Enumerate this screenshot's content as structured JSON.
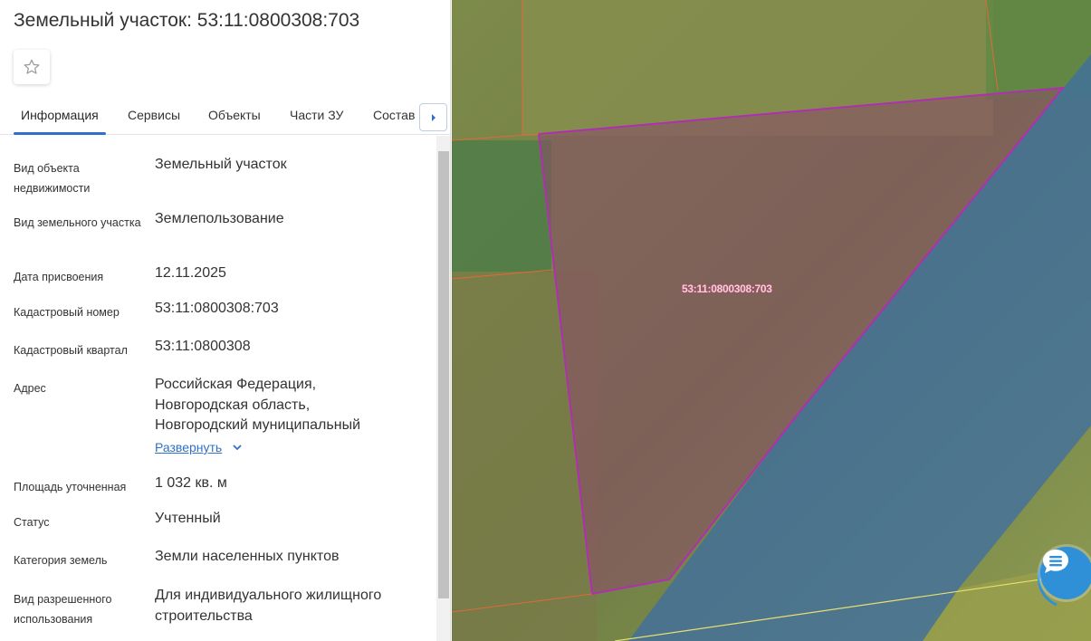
{
  "header": {
    "title": "Земельный участок: 53:11:0800308:703"
  },
  "tabs": [
    {
      "label": "Информация"
    },
    {
      "label": "Сервисы"
    },
    {
      "label": "Объекты"
    },
    {
      "label": "Части ЗУ"
    },
    {
      "label": "Состав"
    }
  ],
  "info": {
    "object_type": {
      "label": "Вид объекта недвижимости",
      "value": "Земельный участок"
    },
    "parcel_type": {
      "label": "Вид земельного участка",
      "value": "Землепользование"
    },
    "assigned_date": {
      "label": "Дата присвоения",
      "value": "12.11.2025"
    },
    "cadastral_number": {
      "label": "Кадастровый номер",
      "value": "53:11:0800308:703"
    },
    "cadastral_block": {
      "label": "Кадастровый квартал",
      "value": "53:11:0800308"
    },
    "address": {
      "label": "Адрес",
      "value": "Российская Федерация, Новгородская область, Новгородский муниципальный",
      "expand_label": "Развернуть"
    },
    "area": {
      "label": "Площадь уточненная",
      "value": "1 032 кв. м"
    },
    "status": {
      "label": "Статус",
      "value": "Учтенный"
    },
    "land_category": {
      "label": "Категория земель",
      "value": "Земли населенных пунктов"
    },
    "permitted_use": {
      "label": "Вид разрешенного использования",
      "value": "Для индивидуального жилищного строительства"
    }
  },
  "map": {
    "parcel_label": "53:11:0800308:703"
  },
  "icons": [
    "star-icon",
    "chevron-right-icon",
    "chevron-down-icon",
    "chat-icon"
  ],
  "colors": {
    "accent": "#2f71c8",
    "parcel_border": "#b02fb0",
    "zone_fill": "#3a6ca8",
    "boundary": "#e06a3a"
  }
}
